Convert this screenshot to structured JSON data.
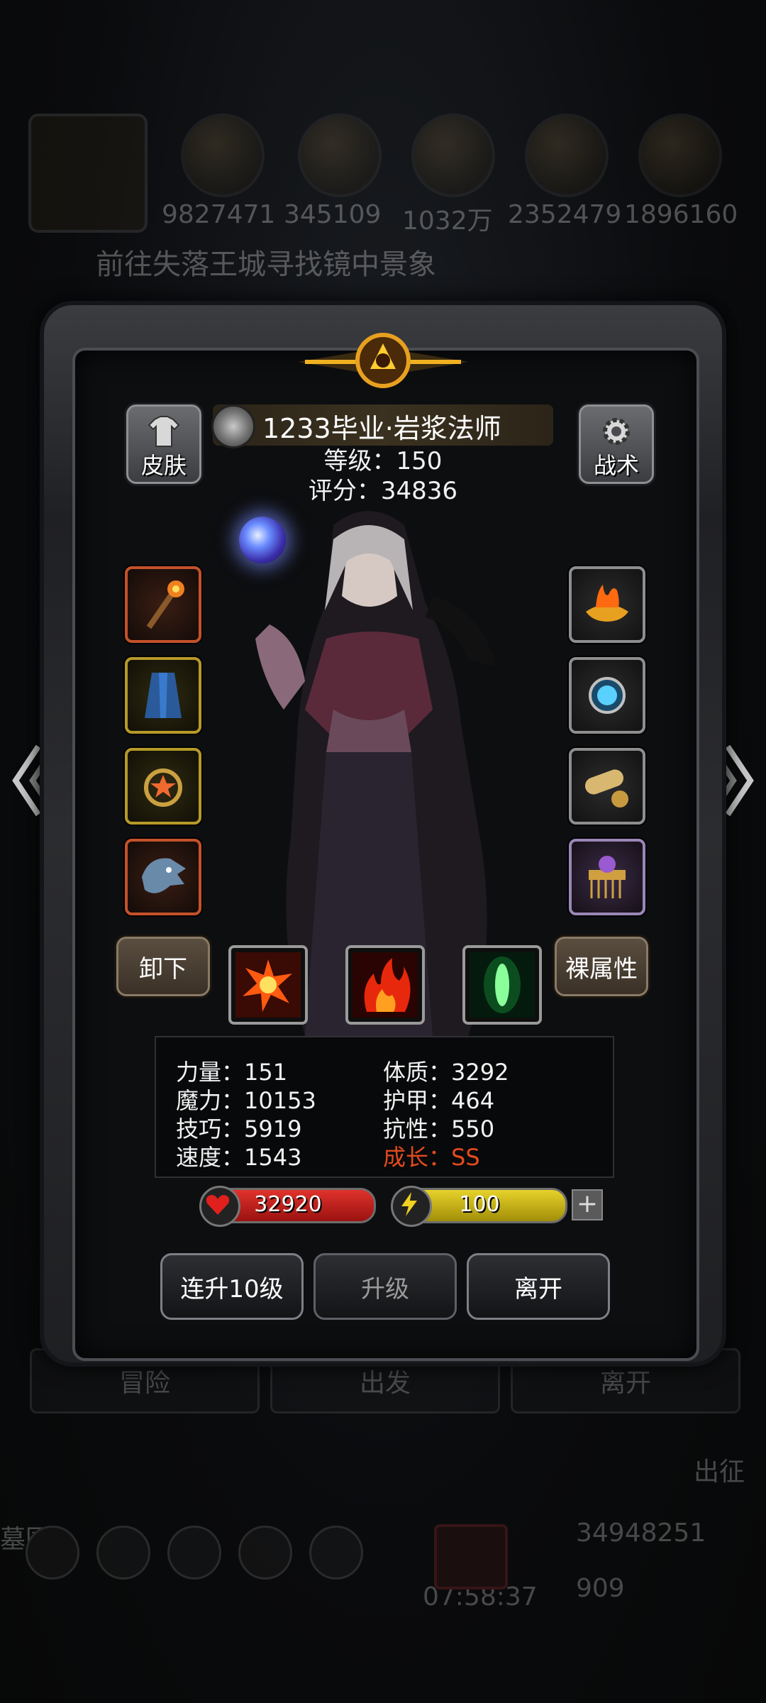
{
  "background": {
    "resources": [
      "9827471",
      "345109",
      "1032万",
      "2352479",
      "1896160"
    ],
    "quest": "前往失落王城寻找镜中景象",
    "bottom_buttons": [
      "冒险",
      "出发",
      "离开"
    ],
    "expedition": "出征",
    "guild": "墓园",
    "timer": "07:58:37",
    "gold": "34948251",
    "gems": "909"
  },
  "hero": {
    "name": "1233毕业·岩浆法师",
    "level": "等级：150",
    "score": "评分：34836"
  },
  "buttons": {
    "skin": "皮肤",
    "tactics": "战术",
    "unequip": "卸下",
    "naked_stats": "裸属性",
    "level_up_10": "连升10级",
    "level_up": "升级",
    "leave": "离开"
  },
  "stats": {
    "strength": "力量：151",
    "constitution": "体质：3292",
    "magic": "魔力：10153",
    "armor": "护甲：464",
    "skill": "技巧：5919",
    "resistance": "抗性：550",
    "speed": "速度：1543",
    "growth": "成长：SS"
  },
  "bars": {
    "hp": "32920",
    "energy": "100"
  },
  "colors": {
    "growth": "#e24a1e",
    "hp": "#d0201c",
    "energy": "#d8c418"
  },
  "icons": {
    "equipment_left": [
      "staff-icon",
      "robe-icon",
      "ring-icon",
      "dragon-helm-icon"
    ],
    "equipment_right": [
      "flame-crown-icon",
      "amulet-icon",
      "scroll-icon",
      "comb-icon"
    ],
    "skills": [
      "fire-burst-icon",
      "flame-icon",
      "green-crystal-icon"
    ]
  }
}
